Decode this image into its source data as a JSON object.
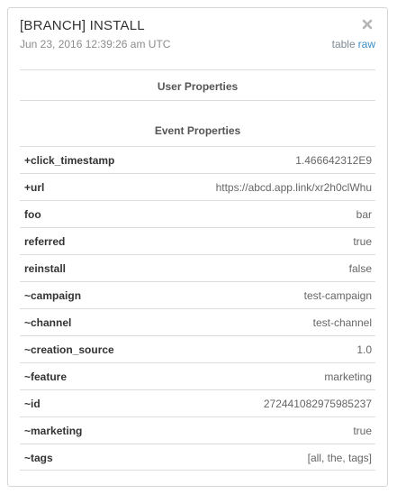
{
  "event": {
    "title": "[BRANCH] INSTALL",
    "timestamp": "Jun 23, 2016 12:39:26 am UTC"
  },
  "view_toggle": {
    "table_label": "table",
    "raw_label": "raw"
  },
  "icons": {
    "close": "close-icon"
  },
  "sections": {
    "user_properties": "User Properties",
    "event_properties": "Event Properties"
  },
  "properties": [
    {
      "key": "+click_timestamp",
      "value": "1.466642312E9"
    },
    {
      "key": "+url",
      "value": "https://abcd.app.link/xr2h0clWhu"
    },
    {
      "key": "foo",
      "value": "bar"
    },
    {
      "key": "referred",
      "value": "true"
    },
    {
      "key": "reinstall",
      "value": "false"
    },
    {
      "key": "~campaign",
      "value": "test-campaign"
    },
    {
      "key": "~channel",
      "value": "test-channel"
    },
    {
      "key": "~creation_source",
      "value": "1.0"
    },
    {
      "key": "~feature",
      "value": "marketing"
    },
    {
      "key": "~id",
      "value": "272441082975985237"
    },
    {
      "key": "~marketing",
      "value": "true"
    },
    {
      "key": "~tags",
      "value": "[all, the, tags]"
    }
  ],
  "colors": {
    "link": "#3b8ec2",
    "muted": "#8c8c8c",
    "border": "#dcdcdc"
  }
}
